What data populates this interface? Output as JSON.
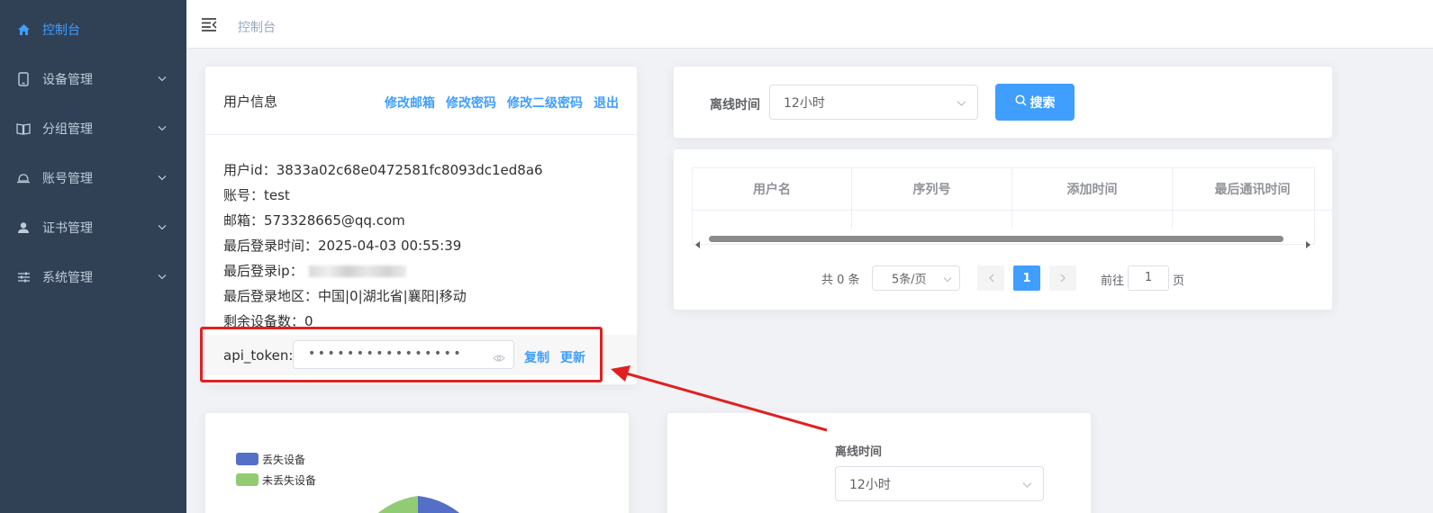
{
  "sidebar": {
    "items": [
      {
        "label": "控制台",
        "icon": "home-icon",
        "active": true
      },
      {
        "label": "设备管理",
        "icon": "tablet-icon"
      },
      {
        "label": "分组管理",
        "icon": "book-icon"
      },
      {
        "label": "账号管理",
        "icon": "bell-icon"
      },
      {
        "label": "证书管理",
        "icon": "user-icon"
      },
      {
        "label": "系统管理",
        "icon": "sliders-icon"
      }
    ]
  },
  "header": {
    "breadcrumb": "控制台",
    "menu_icon": "menu-fold-icon"
  },
  "user_card": {
    "title": "用户信息",
    "links": {
      "change_email": "修改邮箱",
      "change_password": "修改密码",
      "change_second_password": "修改二级密码",
      "logout": "退出"
    },
    "lines": {
      "user_id": "用户id：3833a02c68e0472581fc8093dc1ed8a6",
      "account": "账号：test",
      "email": "邮箱：573328665@qq.com",
      "last_login_time": "最后登录时间：2025-04-03 00:55:39",
      "last_login_ip": "最后登录ip：",
      "last_login_region": "最后登录地区：中国|0|湖北省|襄阳|移动",
      "remaining_devices": "剩余设备数：0"
    },
    "api_token": {
      "label": "api_token:",
      "masked_value": "••••••••••••••••",
      "copy": "复制",
      "refresh": "更新"
    }
  },
  "filter_card": {
    "label": "离线时间",
    "selected": "12小时",
    "search_button": "搜索"
  },
  "table_card": {
    "columns": [
      "用户名",
      "序列号",
      "添加时间",
      "最后通讯时间"
    ],
    "rows": [],
    "pagination": {
      "total": "共 0 条",
      "page_size": "5条/页",
      "current_page": "1",
      "goto_prefix": "前往",
      "goto_value": "1",
      "goto_suffix": "页"
    }
  },
  "pie_card": {
    "legend": [
      {
        "label": "丢失设备",
        "color": "#5470c6"
      },
      {
        "label": "未丢失设备",
        "color": "#91cc75"
      }
    ]
  },
  "filter_card_2": {
    "label": "离线时间",
    "selected": "12小时"
  },
  "colors": {
    "accent": "#409eff",
    "sidebar_bg": "#304156",
    "annotation": "#e02020"
  }
}
